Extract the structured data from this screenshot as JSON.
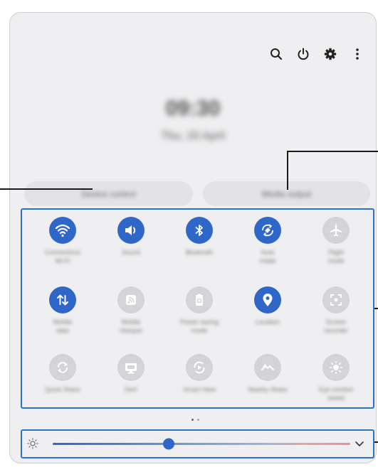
{
  "header": {
    "icons": [
      "search-icon",
      "power-icon",
      "gear-icon",
      "more-vertical-icon"
    ],
    "clock_text": "09:30",
    "date_text": "Thu, 20 April"
  },
  "buttons": {
    "left_pill": "Device control",
    "right_pill": "Media output"
  },
  "tiles": [
    {
      "label": "Connections\nWi-Fi",
      "icon": "wifi-icon",
      "active": true
    },
    {
      "label": "Sound",
      "icon": "volume-icon",
      "active": true
    },
    {
      "label": "Bluetooth",
      "icon": "bluetooth-icon",
      "active": true
    },
    {
      "label": "Auto\nrotate",
      "icon": "auto-rotate-icon",
      "active": true
    },
    {
      "label": "Flight\nmode",
      "icon": "airplane-icon",
      "active": false
    },
    {
      "label": "Mobile\ndata",
      "icon": "mobile-data-icon",
      "active": true
    },
    {
      "label": "Mobile\nHotspot",
      "icon": "hotspot-icon",
      "active": false
    },
    {
      "label": "Power saving\nmode",
      "icon": "battery-icon",
      "active": false
    },
    {
      "label": "Location",
      "icon": "location-icon",
      "active": true
    },
    {
      "label": "Screen\nrecorder",
      "icon": "screen-recorder-icon",
      "active": false
    },
    {
      "label": "Quick Share",
      "icon": "quick-share-icon",
      "active": false
    },
    {
      "label": "DeX",
      "icon": "dex-icon",
      "active": false
    },
    {
      "label": "Smart View",
      "icon": "smart-view-icon",
      "active": false
    },
    {
      "label": "Nearby Share",
      "icon": "nearby-share-icon",
      "active": false
    },
    {
      "label": "Eye comfort\nshield",
      "icon": "eye-comfort-icon",
      "active": false
    }
  ],
  "page_indicator": {
    "current": 1,
    "total": 2
  },
  "brightness": {
    "icon": "sun-icon",
    "level": 0.39,
    "expand_icon": "chevron-down-icon"
  },
  "colors": {
    "accent": "#2f67c9",
    "highlight": "#2e72c7",
    "panel": "#efeff1",
    "inactive": "#d3d3d8"
  }
}
